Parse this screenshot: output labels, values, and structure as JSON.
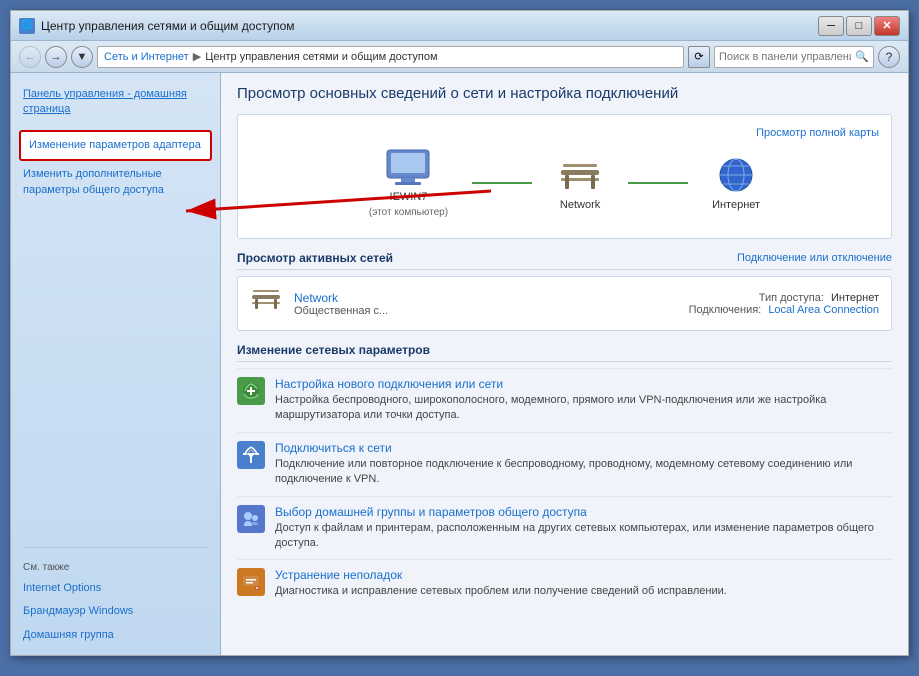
{
  "window": {
    "title": "Центр управления сетями и общим доступом",
    "min_btn": "─",
    "max_btn": "□",
    "close_btn": "✕"
  },
  "addressbar": {
    "back_title": "←",
    "forward_title": "→",
    "dropdown_title": "▼",
    "breadcrumb": [
      {
        "label": "Сеть и Интернет",
        "sep": "▶"
      },
      {
        "label": "Центр управления сетями и общим доступом"
      }
    ],
    "refresh_title": "⟳",
    "search_placeholder": "Поиск в панели управления"
  },
  "sidebar": {
    "home_label": "Панель управления - домашняя страница",
    "link1_label": "Изменение параметров адаптера",
    "link2_label": "Изменить дополнительные параметры общего доступа",
    "see_also_title": "См. также",
    "see_also_links": [
      {
        "label": "Internet Options"
      },
      {
        "label": "Брандмауэр Windows"
      },
      {
        "label": "Домашняя группа"
      }
    ]
  },
  "content": {
    "title": "Просмотр основных сведений о сети и настройка подключений",
    "view_full_map": "Просмотр полной карты",
    "nodes": [
      {
        "label": "IEWIN7",
        "sublabel": "(этот компьютер)",
        "type": "computer"
      },
      {
        "label": "Network",
        "sublabel": "",
        "type": "bench"
      },
      {
        "label": "Интернет",
        "sublabel": "",
        "type": "globe"
      }
    ],
    "active_networks_title": "Просмотр активных сетей",
    "connect_disconnect": "Подключение или отключение",
    "network_name": "Network",
    "network_type": "Общественная с...",
    "access_type_label": "Тип доступа:",
    "access_type_value": "Интернет",
    "connections_label": "Подключения:",
    "connections_value": "Local Area Connection",
    "change_settings_title": "Изменение сетевых параметров",
    "settings": [
      {
        "icon": "⊕",
        "icon_class": "green",
        "title": "Настройка нового подключения или сети",
        "desc": "Настройка беспроводного, широкополосного, модемного, прямого или VPN-подключения или же настройка маршрутизатора или точки доступа."
      },
      {
        "icon": "⊕",
        "icon_class": "blue",
        "title": "Подключиться к сети",
        "desc": "Подключение или повторное подключение к беспроводному, проводному, модемному сетевому соединению или подключение к VPN."
      },
      {
        "icon": "⊕",
        "icon_class": "blue",
        "title": "Выбор домашней группы и параметров общего доступа",
        "desc": "Доступ к файлам и принтерам, расположенным на других сетевых компьютерах, или изменение параметров общего доступа."
      },
      {
        "icon": "⊕",
        "icon_class": "orange",
        "title": "Устранение неполадок",
        "desc": "Диагностика и исправление сетевых проблем или получение сведений об исправлении."
      }
    ]
  }
}
